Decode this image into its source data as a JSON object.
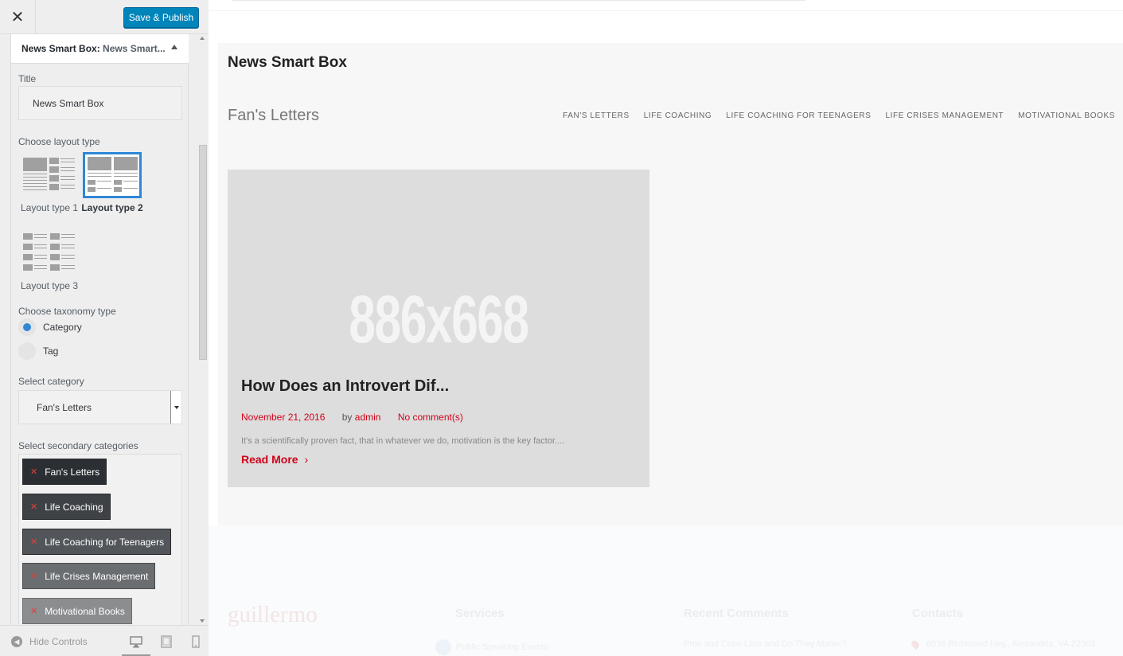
{
  "header": {
    "close_label": "✕",
    "publish_label": "Save & Publish"
  },
  "panel": {
    "title": "News Smart Box:",
    "subtitle": "News Smart...",
    "title_label": "Title",
    "title_value": "News Smart Box",
    "layout_label": "Choose layout type",
    "layouts": [
      {
        "label": "Layout type 1",
        "selected": false
      },
      {
        "label": "Layout type 2",
        "selected": true
      },
      {
        "label": "Layout type 3",
        "selected": false
      }
    ],
    "taxonomy_label": "Choose taxonomy type",
    "taxonomy_options": [
      {
        "label": "Category",
        "checked": true
      },
      {
        "label": "Tag",
        "checked": false
      }
    ],
    "category_label": "Select category",
    "category_value": "Fan's Letters",
    "secondary_label": "Select secondary categories",
    "secondary_tags": [
      {
        "label": "Fan's Letters",
        "color": "#2b2f33"
      },
      {
        "label": "Life Coaching",
        "color": "#3e4246"
      },
      {
        "label": "Life Coaching for Teenagers",
        "color": "#52565a"
      },
      {
        "label": "Life Crises Management",
        "color": "#6b6e71"
      },
      {
        "label": "Motivational Books",
        "color": "#8b8d8f"
      }
    ]
  },
  "footer": {
    "hide_controls": "Hide Controls"
  },
  "preview": {
    "widget_title": "News Smart Box",
    "category_heading": "Fan's Letters",
    "tabs": [
      "Fan's Letters",
      "Life Coaching",
      "Life Coaching for Teenagers",
      "Life Crises Management",
      "Motivational Books"
    ],
    "post": {
      "image_text": "886x668",
      "title": "How Does an Introvert Dif...",
      "date": "November 21, 2016",
      "by": "by",
      "author": "admin",
      "comments": "No comment(s)",
      "excerpt": "It's a scientifically proven fact, that in whatever we do, motivation is the key factor....",
      "read_more": "Read More"
    },
    "site_footer": {
      "logo": "guillermo",
      "columns": [
        "Services",
        "Recent Comments",
        "Contacts"
      ],
      "lines": [
        "Public Speaking Events",
        "Pros and Cons Lists and Do They Matter?",
        "6036 Richmond hwy., Alexandria, VA 22303"
      ]
    }
  },
  "colors": {
    "accent": "#2e88d6",
    "publish": "#0085ba",
    "link_red": "#d0021b"
  }
}
